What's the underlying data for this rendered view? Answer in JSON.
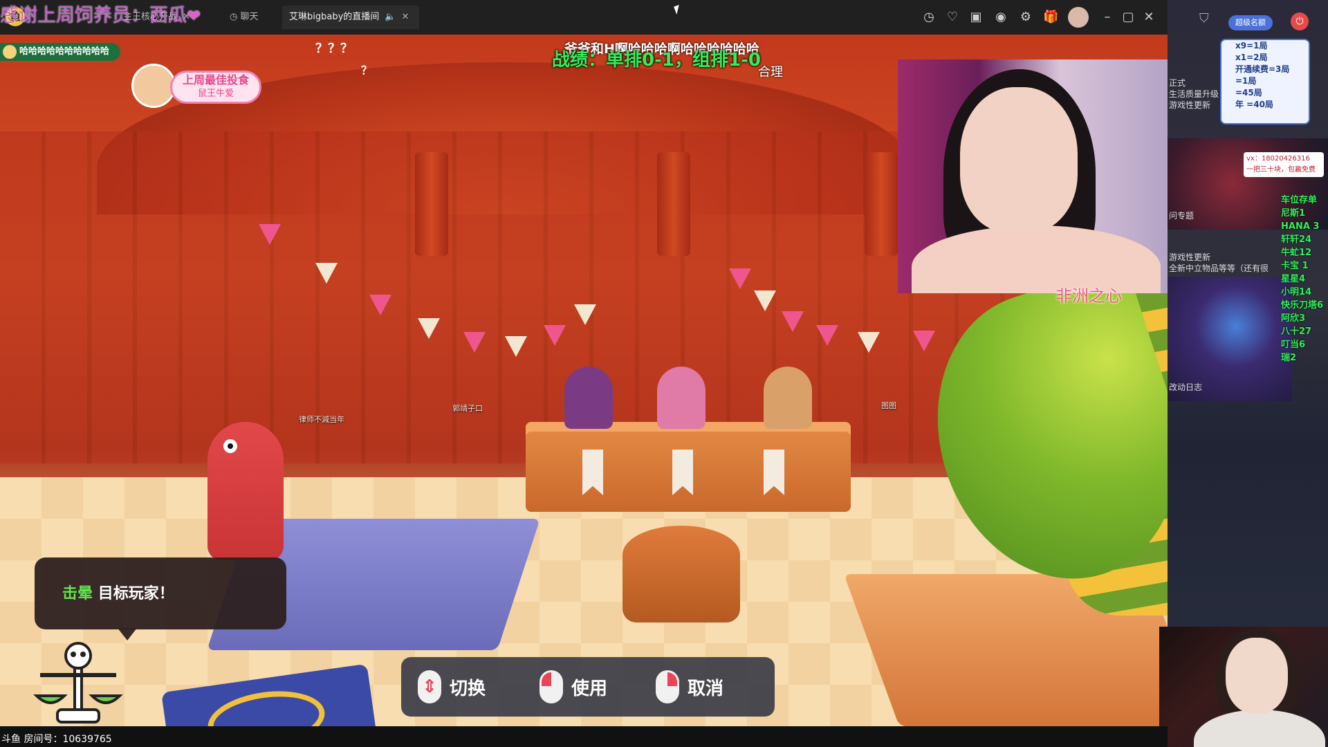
{
  "overlay": {
    "thanks": "感谢上周饲养员：西瓜",
    "streamer_badge": "哈哈哈哈哈哈哈哈哈哈",
    "question_marks": "？？？",
    "question_mark_2": "？",
    "marquee": "爷爷和H啊哈哈哈啊哈哈哈哈哈哈",
    "record": "战绩：单排0-1，组排1-0",
    "record_reason": "合理",
    "best_gift_title": "上周最佳投食",
    "best_gift_name": "鼠王牛爱",
    "africa": "非洲之心",
    "heart_color": "#e05fd0",
    "record_color": "#2ef05a"
  },
  "tabs": {
    "tab1": "主王核心开战",
    "chat": "聊天",
    "live": "艾琳bigbaby的直播间"
  },
  "window_icons": [
    "clock-icon",
    "heart-icon",
    "calendar-icon",
    "chat-icon",
    "settings-icon",
    "gift-icon",
    "avatar",
    "minimize-icon",
    "maximize-icon",
    "close-icon"
  ],
  "game": {
    "hint_highlight": "击晕",
    "hint_text": "目标玩家！",
    "player_tags": [
      "律师不減当年",
      "郭靖子口",
      "图图"
    ],
    "controls": [
      {
        "label": "切换",
        "icon": "scroll-mouse-icon"
      },
      {
        "label": "使用",
        "icon": "left-click-icon"
      },
      {
        "label": "取消",
        "icon": "right-click-icon"
      }
    ]
  },
  "sidebar": {
    "chip": "超级名额",
    "rates": [
      "x9=1局",
      "x1=2局",
      "开通续费=3局",
      "=1局",
      "=45局",
      "年 =40局"
    ],
    "text1": "正式\n生活质量升级\n游戏性更新",
    "promo_line1": "vx：18020426316",
    "promo_line2": "一把三十块，包赢免费",
    "text2": "问专题",
    "text3": "游戏性更新\n全新中立物品等等（还有很",
    "text4": "改动日志",
    "ranking": [
      "车位存单",
      "尼斯1",
      "HANA 3",
      "轩轩24",
      "牛虻12",
      "卡宝 1",
      "星星4",
      "小明14",
      "快乐刀塔6",
      "阿欣3",
      "八十27",
      "叮当6",
      "瑞2"
    ]
  },
  "status": {
    "room": "斗鱼 房间号：10639765"
  }
}
